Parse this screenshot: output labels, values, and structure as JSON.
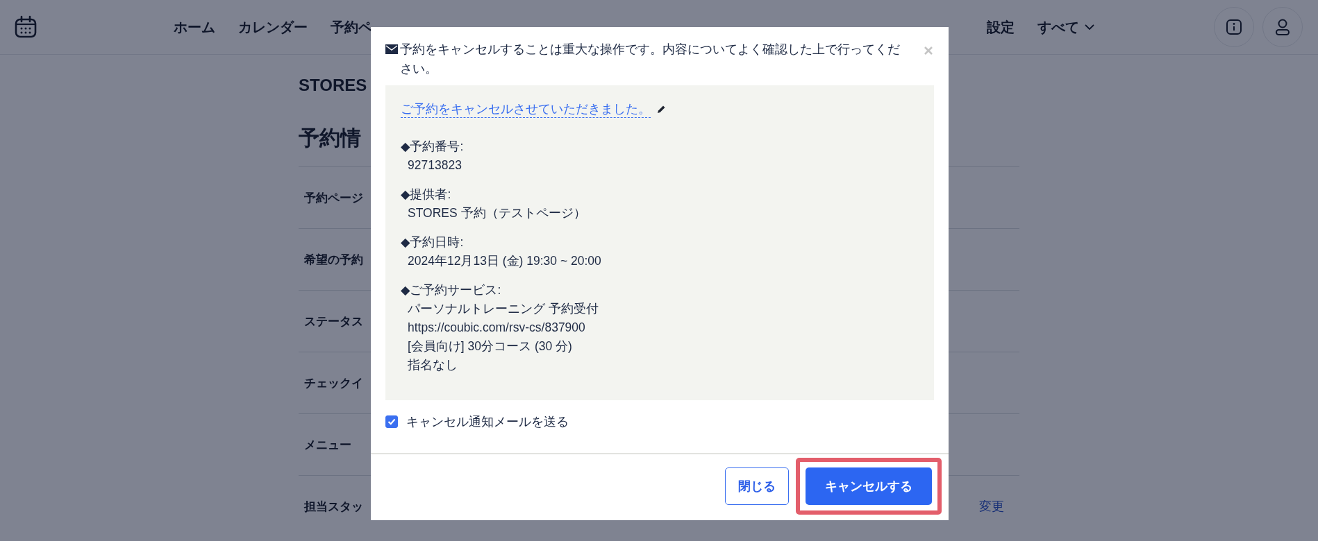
{
  "header": {
    "nav": [
      {
        "label": "ホーム"
      },
      {
        "label": "カレンダー"
      },
      {
        "label": "予約ペ"
      }
    ],
    "nav_right": [
      {
        "label": "設定"
      }
    ],
    "more_label": "すべて"
  },
  "page": {
    "title": "STORES",
    "section": "予約情",
    "rows": [
      {
        "label": "予約ページ"
      },
      {
        "label": "希望の予約"
      },
      {
        "label": "ステータス"
      },
      {
        "label": "チェックイ"
      },
      {
        "label": "メニュー"
      },
      {
        "label": "担当スタッ"
      }
    ],
    "action": "変更"
  },
  "modal": {
    "message": "予約をキャンセルすることは重大な操作です。内容についてよく確認した上で行ってください。",
    "link_text": "ご予約をキャンセルさせていただきました。",
    "details": [
      {
        "label": "◆予約番号:",
        "lines": [
          "92713823"
        ]
      },
      {
        "label": "◆提供者:",
        "lines": [
          "STORES 予約（テストページ）"
        ]
      },
      {
        "label": "◆予約日時:",
        "lines": [
          "2024年12月13日 (金) 19:30 ~ 20:00"
        ]
      },
      {
        "label": "◆ご予約サービス:",
        "lines": [
          "パーソナルトレーニング 予約受付",
          "https://coubic.com/rsv-cs/837900",
          "[会員向け] 30分コース (30 分)",
          "指名なし"
        ]
      }
    ],
    "notify": {
      "label": "キャンセル通知メールを送る",
      "checked": true
    },
    "buttons": [
      {
        "label": "閉じる",
        "kind": "secondary",
        "highlighted": false
      },
      {
        "label": "キャンセルする",
        "kind": "primary",
        "highlighted": true
      }
    ]
  }
}
